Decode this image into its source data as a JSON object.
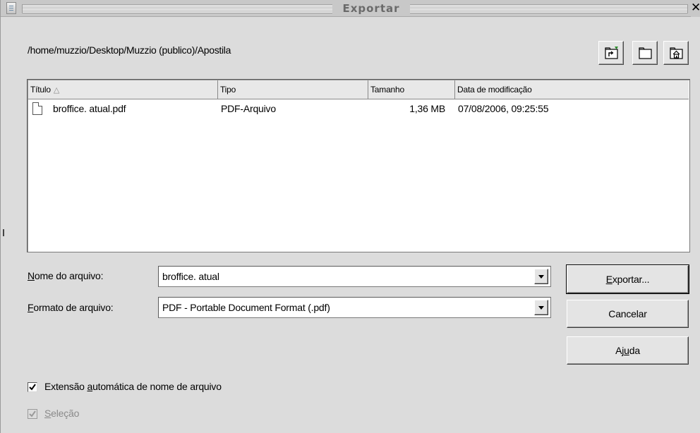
{
  "window": {
    "title": "Exportar",
    "close_glyph": "✕"
  },
  "path": "/home/muzzio/Desktop/Muzzio (publico)/Apostila",
  "toolbar": {
    "up_icon": "folder-up-icon",
    "new_folder_icon": "new-folder-icon",
    "home_icon": "home-folder-icon"
  },
  "file_list": {
    "columns": [
      "Título",
      "Tipo",
      "Tamanho",
      "Data de modificação"
    ],
    "sort_indicator": "△",
    "rows": [
      {
        "name": "broffice. atual.pdf",
        "type": "PDF-Arquivo",
        "size": "1,36 MB",
        "modified": "07/08/2006, 09:25:55"
      }
    ]
  },
  "filename": {
    "label_mnemonic": "N",
    "label_rest": "ome do arquivo:",
    "value": "broffice. atual"
  },
  "format": {
    "label_mnemonic": "F",
    "label_rest": "ormato de arquivo:",
    "value": "PDF - Portable Document Format (.pdf)"
  },
  "buttons": {
    "export_mnemonic": "E",
    "export_rest": "xportar...",
    "cancel": "Cancelar",
    "help_pre": "Aj",
    "help_mnemonic": "u",
    "help_post": "da"
  },
  "options": {
    "auto_ext_pre": "Extensão ",
    "auto_ext_mnemonic": "a",
    "auto_ext_post": "utomática de nome de arquivo",
    "auto_ext_checked": true,
    "selection_mnemonic": "S",
    "selection_rest": "eleção",
    "selection_checked": true,
    "selection_enabled": false
  }
}
